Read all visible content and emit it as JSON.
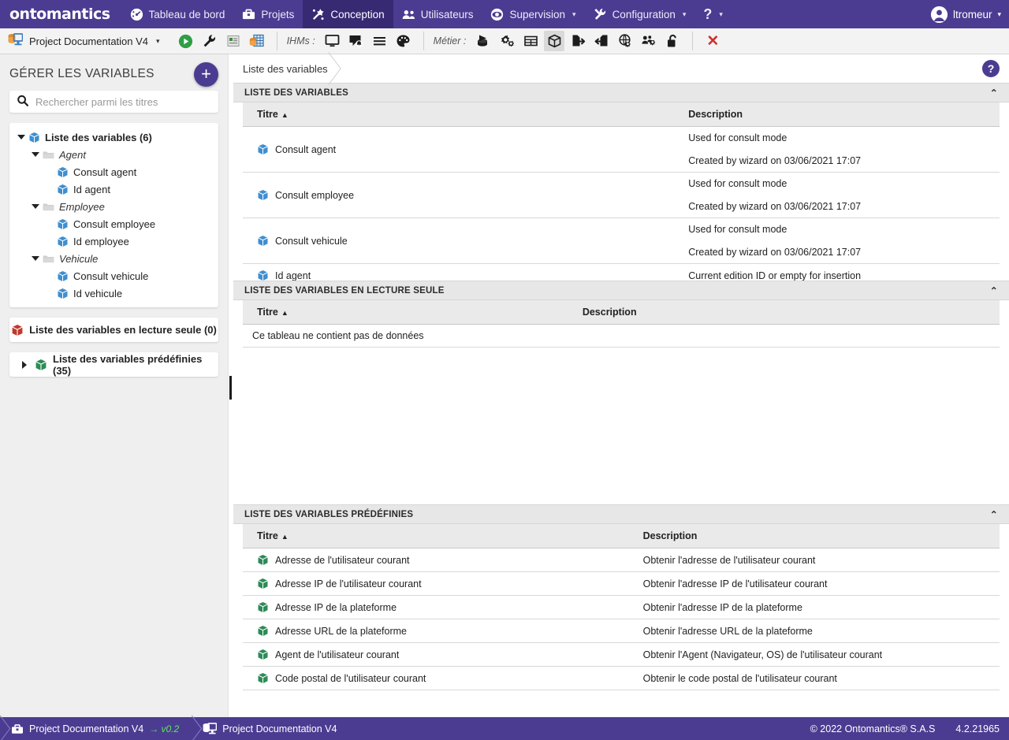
{
  "topnav": {
    "brand": "ontomantics",
    "items": [
      {
        "label": "Tableau de bord",
        "icon": "dashboard-icon",
        "active": false,
        "caret": false
      },
      {
        "label": "Projets",
        "icon": "toolbox-icon",
        "active": false,
        "caret": false
      },
      {
        "label": "Conception",
        "icon": "design-icon",
        "active": true,
        "caret": false
      },
      {
        "label": "Utilisateurs",
        "icon": "users-icon",
        "active": false,
        "caret": false
      },
      {
        "label": "Supervision",
        "icon": "eye-icon",
        "active": false,
        "caret": true
      },
      {
        "label": "Configuration",
        "icon": "tools-icon",
        "active": false,
        "caret": true
      },
      {
        "label": "?",
        "icon": "help-icon",
        "active": false,
        "caret": true
      }
    ],
    "user": {
      "name": "ltromeur",
      "icon": "avatar-icon",
      "caret": "▾"
    },
    "background": "#4b3c91",
    "active_background": "#372a73"
  },
  "toolbar": {
    "project_label": "Project Documentation V4",
    "project_icon": "database-screen-icon",
    "project_caret": "▾",
    "actions": [
      {
        "name": "run-button",
        "icon": "play-icon"
      },
      {
        "name": "build-button",
        "icon": "wrench-icon"
      },
      {
        "name": "report-button",
        "icon": "report-icon"
      },
      {
        "name": "data-button",
        "icon": "database-table-icon"
      }
    ],
    "group_ihm_label": "IHMs :",
    "ihm_actions": [
      {
        "name": "screen-button",
        "icon": "monitor-icon"
      },
      {
        "name": "popup-button",
        "icon": "popup-alert-icon"
      },
      {
        "name": "menu-button",
        "icon": "menu-lines-icon"
      },
      {
        "name": "theme-button",
        "icon": "palette-icon"
      }
    ],
    "group_metier_label": "Métier :",
    "metier_actions": [
      {
        "name": "process-button",
        "icon": "process-icon",
        "selected": false
      },
      {
        "name": "rules-button",
        "icon": "gears-icon",
        "selected": false
      },
      {
        "name": "tables-button",
        "icon": "table-icon",
        "selected": false
      },
      {
        "name": "variables-button",
        "icon": "cube-icon",
        "selected": true
      },
      {
        "name": "export-button",
        "icon": "file-out-icon",
        "selected": false
      },
      {
        "name": "import-button",
        "icon": "file-in-icon",
        "selected": false
      },
      {
        "name": "webservice-button",
        "icon": "globe-gear-icon",
        "selected": false
      },
      {
        "name": "roles-button",
        "icon": "users-gear-icon",
        "selected": false
      },
      {
        "name": "security-button",
        "icon": "padlock-open-icon",
        "selected": false
      }
    ],
    "close_label": "✕",
    "close_color": "#d32f2f"
  },
  "sidebar": {
    "title": "GÉRER LES VARIABLES",
    "add_button_label": "+",
    "search_placeholder": "Rechercher parmi les titres",
    "search_value": "",
    "search_icon": "search-icon",
    "tree": [
      {
        "label": "Liste des variables (6)",
        "level": 0,
        "type": "root",
        "icon": "cube-blue-icon",
        "expanded": true
      },
      {
        "label": "Agent",
        "level": 1,
        "type": "folder",
        "icon": "folder-icon",
        "expanded": true
      },
      {
        "label": "Consult agent",
        "level": 2,
        "type": "leaf",
        "icon": "cube-blue-icon"
      },
      {
        "label": "Id agent",
        "level": 2,
        "type": "leaf",
        "icon": "cube-blue-icon"
      },
      {
        "label": "Employee",
        "level": 1,
        "type": "folder",
        "icon": "folder-icon",
        "expanded": true
      },
      {
        "label": "Consult employee",
        "level": 2,
        "type": "leaf",
        "icon": "cube-blue-icon"
      },
      {
        "label": "Id employee",
        "level": 2,
        "type": "leaf",
        "icon": "cube-blue-icon"
      },
      {
        "label": "Vehicule",
        "level": 1,
        "type": "folder",
        "icon": "folder-icon",
        "expanded": true
      },
      {
        "label": "Consult vehicule",
        "level": 2,
        "type": "leaf",
        "icon": "cube-blue-icon"
      },
      {
        "label": "Id vehicule",
        "level": 2,
        "type": "leaf",
        "icon": "cube-blue-icon"
      }
    ],
    "readonly_button": {
      "label": "Liste des variables en lecture seule (0)",
      "icon": "cube-red-icon"
    },
    "predefined_button": {
      "label": "Liste des variables prédéfinies (35)",
      "icon": "cube-green-icon",
      "expanded": false
    }
  },
  "breadcrumb": {
    "items": [
      "Liste des variables"
    ],
    "help_label": "?"
  },
  "panels": [
    {
      "name": "variables-panel",
      "title": "LISTE DES VARIABLES",
      "chevron": "⌃",
      "columns": [
        "Titre",
        "Description"
      ],
      "sort_column": "Titre",
      "sort_arrow": "▲",
      "rows": [
        {
          "title": "Consult agent",
          "icon": "cube-blue-icon",
          "desc1": "Used for consult mode",
          "desc2": "Created by wizard on 03/06/2021 17:07"
        },
        {
          "title": "Consult employee",
          "icon": "cube-blue-icon",
          "desc1": "Used for consult mode",
          "desc2": "Created by wizard on 03/06/2021 17:07"
        },
        {
          "title": "Consult vehicule",
          "icon": "cube-blue-icon",
          "desc1": "Used for consult mode",
          "desc2": "Created by wizard on 03/06/2021 17:07"
        },
        {
          "title": "Id agent",
          "icon": "cube-blue-icon",
          "desc1": "Current edition ID or empty for insertion",
          "desc2": ""
        }
      ]
    },
    {
      "name": "readonly-variables-panel",
      "title": "LISTE DES VARIABLES EN LECTURE SEULE",
      "chevron": "⌃",
      "columns": [
        "Titre",
        "Description"
      ],
      "sort_column": "Titre",
      "sort_arrow": "▲",
      "empty_message": "Ce tableau ne contient pas de données",
      "rows": []
    },
    {
      "name": "predefined-variables-panel",
      "title": "LISTE DES VARIABLES PRÉDÉFINIES",
      "chevron": "⌃",
      "columns": [
        "Titre",
        "Description"
      ],
      "sort_column": "Titre",
      "sort_arrow": "▲",
      "rows": [
        {
          "title": "Adresse de l'utilisateur courant",
          "icon": "cube-green-icon",
          "desc1": "Obtenir l'adresse de l'utilisateur courant",
          "desc2": ""
        },
        {
          "title": "Adresse IP de l'utilisateur courant",
          "icon": "cube-green-icon",
          "desc1": "Obtenir l'adresse IP de l'utilisateur courant",
          "desc2": ""
        },
        {
          "title": "Adresse IP de la plateforme",
          "icon": "cube-green-icon",
          "desc1": "Obtenir l'adresse IP de la plateforme",
          "desc2": ""
        },
        {
          "title": "Adresse URL de la plateforme",
          "icon": "cube-green-icon",
          "desc1": "Obtenir l'adresse URL de la plateforme",
          "desc2": ""
        },
        {
          "title": "Agent de l'utilisateur courant",
          "icon": "cube-green-icon",
          "desc1": "Obtenir l'Agent (Navigateur, OS) de l'utilisateur courant",
          "desc2": ""
        },
        {
          "title": "Code postal de l'utilisateur courant",
          "icon": "cube-green-icon",
          "desc1": "Obtenir le code postal de l'utilisateur courant",
          "desc2": ""
        }
      ]
    }
  ],
  "footer": {
    "items": [
      {
        "label": "Project Documentation V4",
        "suffix": "→ v0.2",
        "icon": "toolbox-icon",
        "suffix_color": "#5ce65c"
      },
      {
        "label": "Project Documentation V4",
        "suffix": "",
        "icon": "database-screen-icon",
        "suffix_color": ""
      }
    ],
    "copyright": "© 2022 Ontomantics® S.A.S",
    "version": "4.2.21965",
    "background": "#4b3c91"
  }
}
